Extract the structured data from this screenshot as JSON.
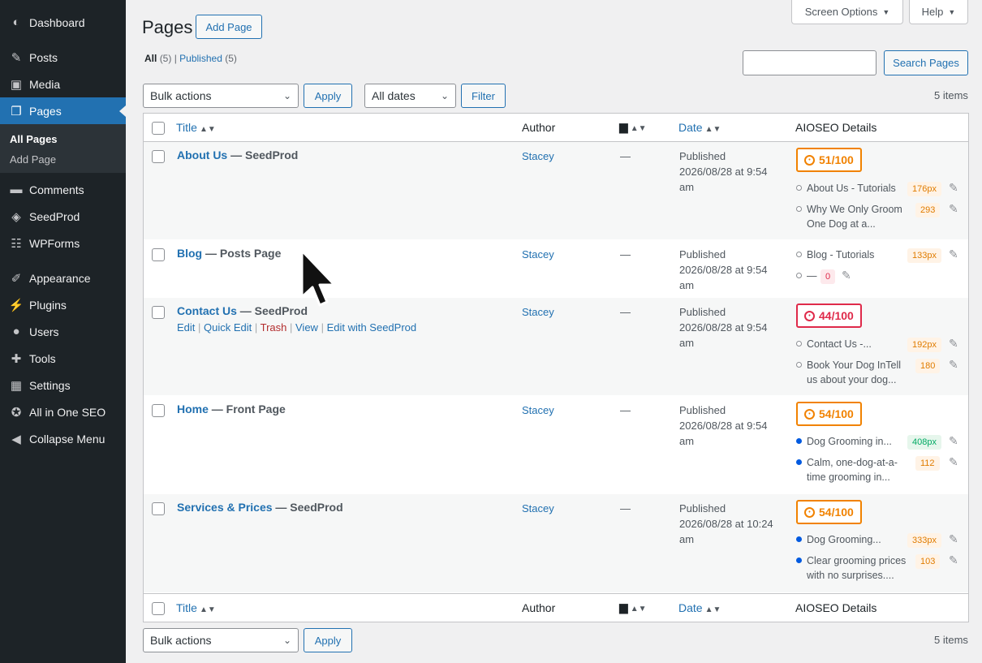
{
  "sidebar": {
    "items": [
      {
        "label": "Dashboard",
        "icon": "dashboard-icon",
        "glyph": "◐"
      },
      {
        "label": "Posts",
        "icon": "pin-icon",
        "glyph": "✎"
      },
      {
        "label": "Media",
        "icon": "media-icon",
        "glyph": "▣"
      },
      {
        "label": "Pages",
        "icon": "pages-icon",
        "glyph": "❐"
      },
      {
        "label": "Comments",
        "icon": "comment-icon",
        "glyph": "▬"
      },
      {
        "label": "SeedProd",
        "icon": "seedprod-icon",
        "glyph": "◈"
      },
      {
        "label": "WPForms",
        "icon": "wpforms-icon",
        "glyph": "☷"
      },
      {
        "label": "Appearance",
        "icon": "brush-icon",
        "glyph": "✐"
      },
      {
        "label": "Plugins",
        "icon": "plugin-icon",
        "glyph": "⚡"
      },
      {
        "label": "Users",
        "icon": "user-icon",
        "glyph": "●"
      },
      {
        "label": "Tools",
        "icon": "wrench-icon",
        "glyph": "✚"
      },
      {
        "label": "Settings",
        "icon": "settings-icon",
        "glyph": "▦"
      },
      {
        "label": "All in One SEO",
        "icon": "aioseo-icon",
        "glyph": "✪"
      },
      {
        "label": "Collapse Menu",
        "icon": "collapse-icon",
        "glyph": "◀"
      }
    ],
    "submenu": [
      "All Pages",
      "Add Page"
    ]
  },
  "header": {
    "screen_options": "Screen Options",
    "help": "Help",
    "title": "Pages",
    "add_page": "Add Page",
    "filter_all": "All",
    "filter_all_count": "(5)",
    "filter_published": "Published",
    "filter_published_count": "(5)",
    "search_value": "",
    "search_button": "Search Pages"
  },
  "toolbar": {
    "bulk_actions": "Bulk actions",
    "apply": "Apply",
    "all_dates": "All dates",
    "filter": "Filter",
    "items_count": "5 items"
  },
  "table": {
    "columns": {
      "title": "Title",
      "author": "Author",
      "date": "Date",
      "aioseo": "AIOSEO Details"
    },
    "rows": [
      {
        "title": "About Us",
        "state": " — SeedProd",
        "author": "Stacey",
        "comments": "—",
        "date_status": "Published",
        "date_value": "2026/08/28 at 9:54 am",
        "score": "51/100",
        "score_color": "#f18200",
        "seo": [
          {
            "text": "About Us - Tutorials",
            "badge": "176px",
            "badge_color": "orange"
          },
          {
            "text": "Why We Only Groom One Dog at a...",
            "badge": "293",
            "badge_color": "orange"
          }
        ]
      },
      {
        "title": "Blog",
        "state": " — Posts Page",
        "author": "Stacey",
        "comments": "—",
        "date_status": "Published",
        "date_value": "2026/08/28 at 9:54 am",
        "seo": [
          {
            "text": "Blog - Tutorials",
            "badge": "133px",
            "badge_color": "orange"
          },
          {
            "text": "—",
            "badge": "0",
            "badge_color": "red"
          }
        ]
      },
      {
        "title": "Contact Us",
        "state": " — SeedProd",
        "author": "Stacey",
        "comments": "—",
        "date_status": "Published",
        "date_value": "2026/08/28 at 9:54 am",
        "actions": [
          "Edit",
          "Quick Edit",
          "Trash",
          "View",
          "Edit with SeedProd"
        ],
        "score": "44/100",
        "score_color": "#df2a4a",
        "seo": [
          {
            "text": "Contact Us -...",
            "badge": "192px",
            "badge_color": "orange"
          },
          {
            "text": "Book Your Dog InTell us about your dog...",
            "badge": "180",
            "badge_color": "orange"
          }
        ]
      },
      {
        "title": "Home",
        "state": " — Front Page",
        "author": "Stacey",
        "comments": "—",
        "date_status": "Published",
        "date_value": "2026/08/28 at 9:54 am",
        "score": "54/100",
        "score_color": "#f18200",
        "seo": [
          {
            "text": "Dog Grooming in...",
            "badge": "408px",
            "badge_color": "green"
          },
          {
            "text": "Calm, one-dog-at-a-time grooming in...",
            "badge": "112",
            "badge_color": "orange"
          }
        ]
      },
      {
        "title": "Services & Prices",
        "state": " — SeedProd",
        "author": "Stacey",
        "comments": "—",
        "date_status": "Published",
        "date_value": "2026/08/28 at 10:24 am",
        "score": "54/100",
        "score_color": "#f18200",
        "seo": [
          {
            "text": "Dog Grooming...",
            "badge": "333px",
            "badge_color": "orange"
          },
          {
            "text": "Clear grooming prices with no surprises....",
            "badge": "103",
            "badge_color": "orange"
          }
        ]
      }
    ]
  },
  "colors": {
    "accent": "#2271b1",
    "sidebar_bg": "#1d2327",
    "score_orange": "#f18200",
    "score_red": "#df2a4a"
  }
}
